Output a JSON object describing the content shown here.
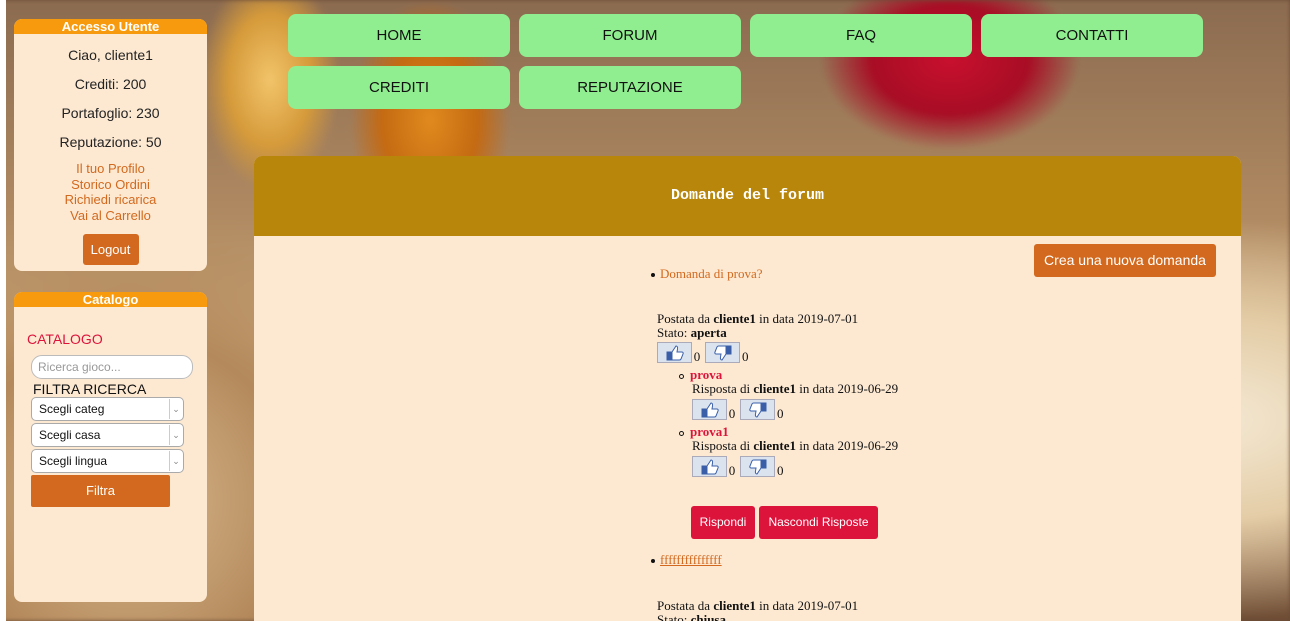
{
  "user_panel": {
    "title": "Accesso Utente",
    "greeting": "Ciao, cliente1",
    "crediti": "Crediti: 200",
    "portafoglio": "Portafoglio: 230",
    "reputazione": "Reputazione: 50",
    "links": [
      "Il tuo Profilo",
      "Storico Ordini",
      "Richiedi ricarica",
      "Vai al Carrello"
    ],
    "logout": "Logout"
  },
  "catalog_panel": {
    "title": "Catalogo",
    "heading": "CATALOGO",
    "search_placeholder": "Ricerca gioco...",
    "filter_label": "FILTRA RICERCA",
    "selects": [
      "Scegli categ",
      "Scegli casa",
      "Scegli lingua"
    ],
    "filter_button": "Filtra"
  },
  "nav": {
    "items": [
      "HOME",
      "FORUM",
      "FAQ",
      "CONTATTI",
      "CREDITI",
      "REPUTAZIONE"
    ]
  },
  "main": {
    "header": "Domande del forum",
    "new_question_button": "Crea una nuova domanda",
    "questions": [
      {
        "title": "Domanda di prova?",
        "posted_prefix": "Postata da",
        "author": "cliente1",
        "date_prefix": "in data",
        "date": "2019-07-01",
        "state_label": "Stato:",
        "state": "aperta",
        "likes": "0",
        "dislikes": "0",
        "answers": [
          {
            "title": "prova",
            "prefix": "Risposta di",
            "author": "cliente1",
            "date_prefix": "in data",
            "date": "2019-06-29",
            "likes": "0",
            "dislikes": "0"
          },
          {
            "title": "prova1",
            "prefix": "Risposta di",
            "author": "cliente1",
            "date_prefix": "in data",
            "date": "2019-06-29",
            "likes": "0",
            "dislikes": "0"
          }
        ],
        "reply_button": "Rispondi",
        "hide_button": "Nascondi Risposte"
      },
      {
        "title": "fffffffffffffff",
        "posted_prefix": "Postata da",
        "author": "cliente1",
        "date_prefix": "in data",
        "date": "2019-07-01",
        "state_label": "Stato:",
        "state": "chiusa"
      }
    ]
  },
  "colors": {
    "nav_bg": "#90ee90",
    "panel_head": "#f79a0e",
    "panel_bg": "#fde9d2",
    "main_header": "#b8860b",
    "accent_button": "#d2691e",
    "red_button": "#dc143c"
  },
  "icons": [
    "thumbs-up-icon",
    "thumbs-down-icon",
    "chevron-down-icon"
  ]
}
